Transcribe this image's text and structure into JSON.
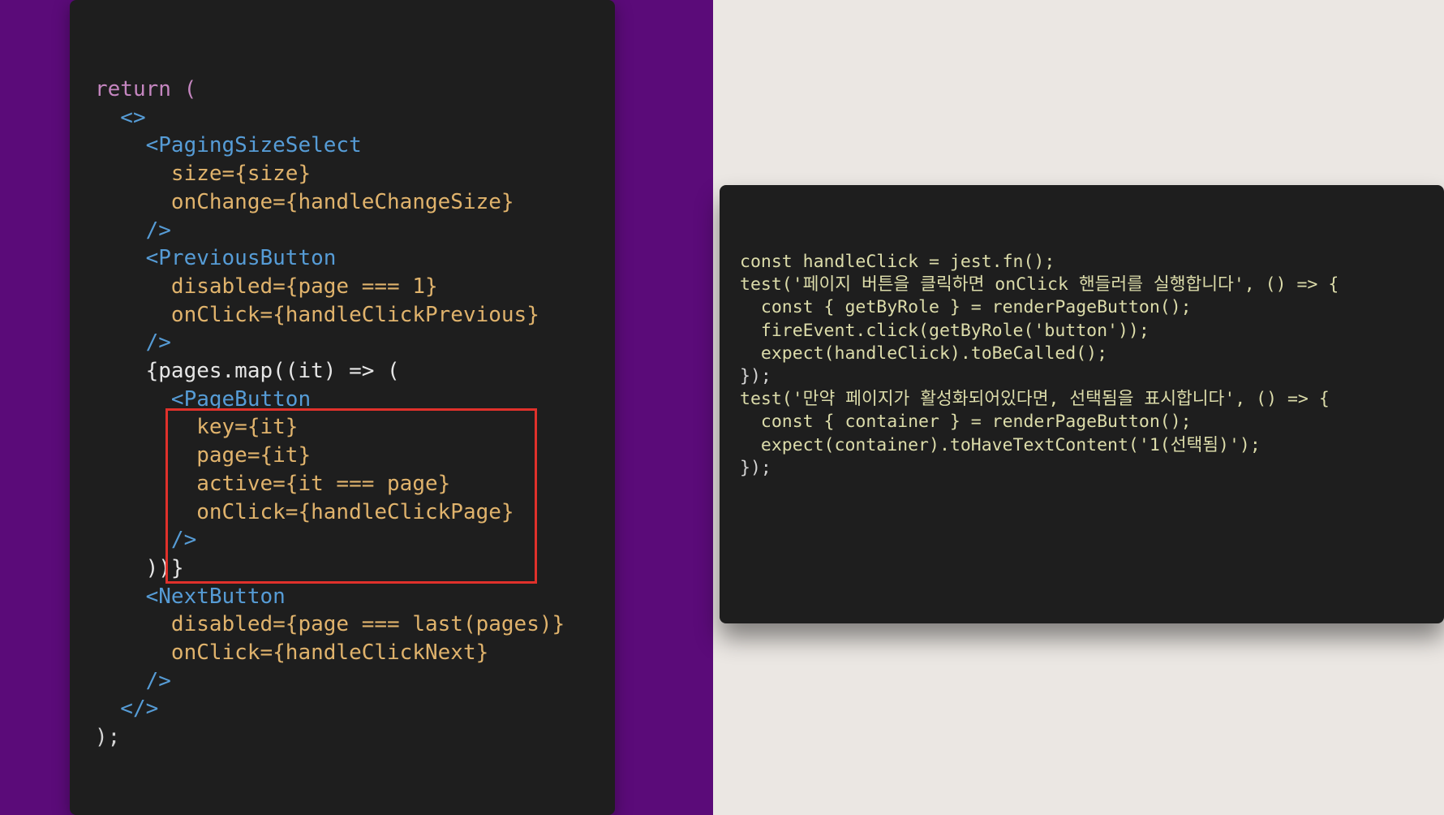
{
  "colors": {
    "left_background": "#5b0b79",
    "right_background": "#ebe7e3",
    "editor_background": "#1e1e1e",
    "traffic_close": "#ef5a52",
    "traffic_minimize": "#f3b935",
    "traffic_zoom": "#3fc342",
    "highlight_border": "#e0312b"
  },
  "left_window": {
    "lines": [
      "return (",
      "  <>",
      "    <PagingSizeSelect",
      "      size={size}",
      "      onChange={handleChangeSize}",
      "    />",
      "",
      "    <PreviousButton",
      "      disabled={page === 1}",
      "      onClick={handleClickPrevious}",
      "    />",
      "    {pages.map((it) => (",
      "      <PageButton",
      "        key={it}",
      "        page={it}",
      "        active={it === page}",
      "        onClick={handleClickPage}",
      "      />",
      "    ))}",
      "    <NextButton",
      "      disabled={page === last(pages)}",
      "      onClick={handleClickNext}",
      "    />",
      "  </>",
      ");"
    ]
  },
  "right_window": {
    "lines": [
      "const handleClick = jest.fn();",
      "",
      "test('페이지 버튼을 클릭하면 onClick 핸들러를 실행합니다', () => {",
      "  const { getByRole } = renderPageButton();",
      "",
      "  fireEvent.click(getByRole('button'));",
      "",
      "  expect(handleClick).toBeCalled();",
      "});",
      "",
      "test('만약 페이지가 활성화되어있다면, 선택됨을 표시합니다', () => {",
      "  const { container } = renderPageButton();",
      "",
      "  expect(container).toHaveTextContent('1(선택됨)');",
      "});"
    ]
  }
}
